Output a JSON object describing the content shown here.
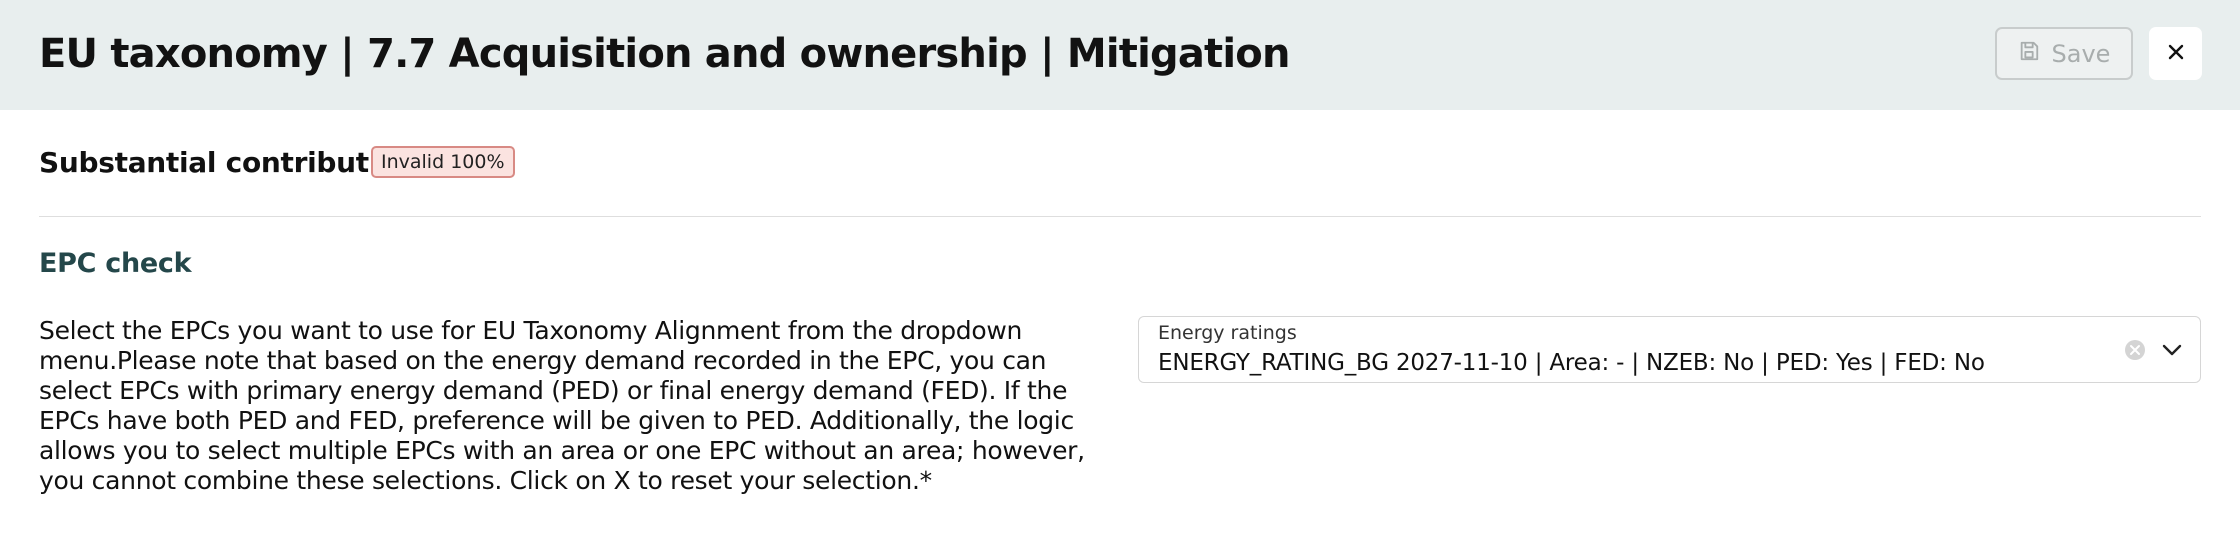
{
  "header": {
    "title": "EU taxonomy | 7.7 Acquisition and ownership | Mitigation",
    "save_label": "Save",
    "save_icon": "floppy-disk-icon",
    "close_icon": "close-icon"
  },
  "section": {
    "title": "Substantial contribution",
    "badge": "Invalid 100%",
    "badge_bg": "#fbe3e0",
    "badge_border": "#d88a84"
  },
  "epc": {
    "title": "EPC check",
    "title_color": "#24474a",
    "description": "Select the EPCs you want to use for EU Taxonomy Alignment from the dropdown menu.Please note that based on the energy demand recorded in the EPC, you can select EPCs with primary energy demand (PED) or final energy demand (FED). If the EPCs have both PED and FED, preference will be given to PED. Additionally, the logic allows you to select multiple EPCs with an area or one EPC without an area; however, you cannot combine these selections. Click on X to reset your selection.*",
    "select": {
      "label": "Energy ratings",
      "value": "ENERGY_RATING_BG 2027-11-10 | Area: - | NZEB: No | PED: Yes | FED: No",
      "clear_icon": "clear-circle-icon",
      "dropdown_icon": "chevron-down-icon"
    }
  },
  "colors": {
    "header_bg": "#e8eeee",
    "text": "#111111"
  }
}
